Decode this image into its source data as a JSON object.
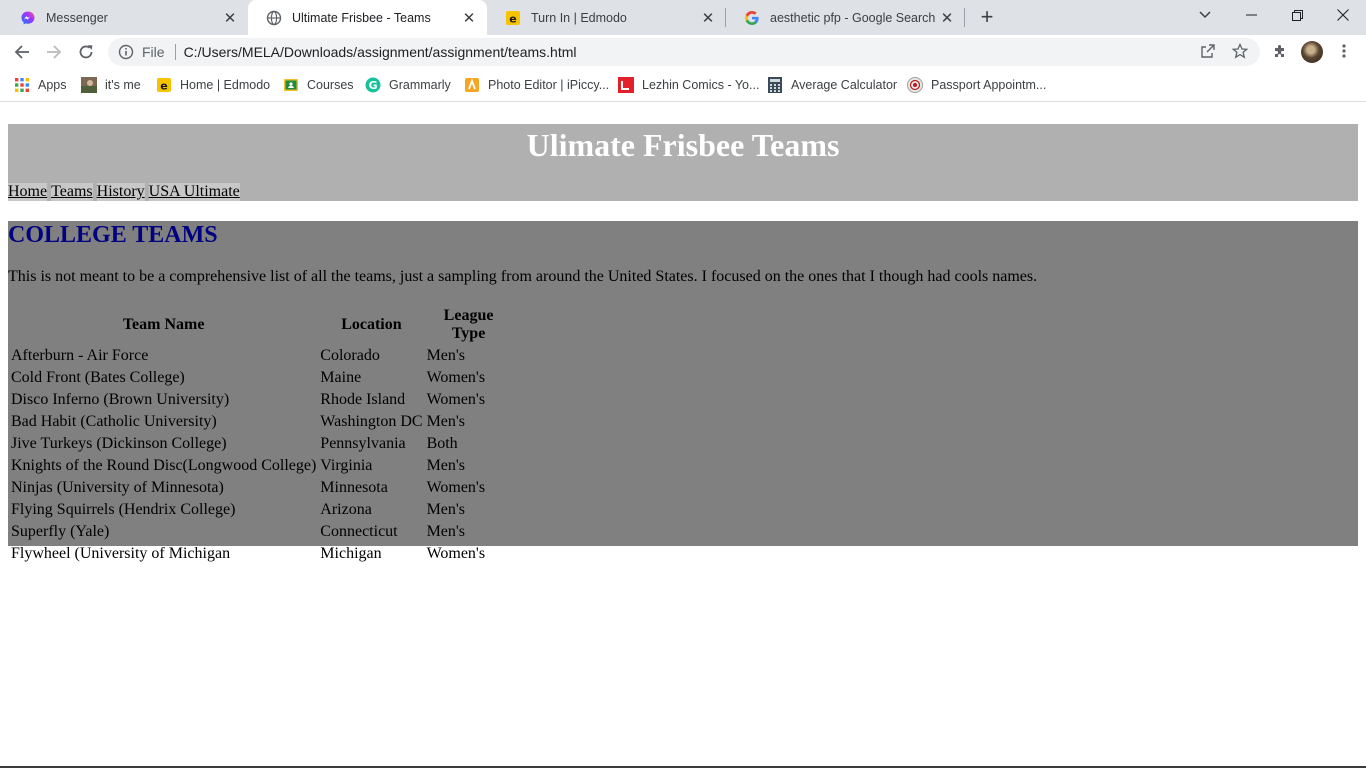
{
  "browser": {
    "tabs": [
      {
        "title": "Messenger",
        "icon": "messenger-icon",
        "active": false
      },
      {
        "title": "Ultimate Frisbee - Teams",
        "icon": "globe-icon",
        "active": true
      },
      {
        "title": "Turn In | Edmodo",
        "icon": "edmodo-icon",
        "active": false
      },
      {
        "title": "aesthetic pfp - Google Search",
        "icon": "google-icon",
        "active": false
      }
    ],
    "new_tab_label": "+",
    "address": {
      "scheme": "File",
      "url": "C:/Users/MELA/Downloads/assignment/assignment/teams.html"
    },
    "bookmarks": [
      {
        "label": "Apps",
        "icon": "apps-grid-icon"
      },
      {
        "label": "it's me",
        "icon": "photo-icon"
      },
      {
        "label": "Home | Edmodo",
        "icon": "edmodo-icon"
      },
      {
        "label": "Courses",
        "icon": "classroom-icon"
      },
      {
        "label": "Grammarly",
        "icon": "grammarly-icon"
      },
      {
        "label": "Photo Editor | iPiccy...",
        "icon": "ipiccy-icon"
      },
      {
        "label": "Lezhin Comics - Yo...",
        "icon": "lezhin-icon"
      },
      {
        "label": "Average Calculator",
        "icon": "calculator-icon"
      },
      {
        "label": "Passport Appointm...",
        "icon": "passport-seal-icon"
      }
    ]
  },
  "page": {
    "site_title": "Ulimate Frisbee Teams",
    "nav": [
      "Home",
      "Teams",
      "History",
      "USA Ultimate"
    ],
    "section_heading": "COLLEGE TEAMS",
    "intro": "This is not meant to be a comprehensive list of all the teams, just a sampling from around the United States. I focused on the ones that I though had cools names.",
    "table": {
      "headers": [
        "Team Name",
        "Location",
        "League Type"
      ],
      "rows": [
        [
          "Afterburn - Air Force",
          "Colorado",
          "Men's"
        ],
        [
          "Cold Front (Bates College)",
          "Maine",
          "Women's"
        ],
        [
          "Disco Inferno (Brown University)",
          "Rhode Island",
          "Women's"
        ],
        [
          "Bad Habit (Catholic University)",
          "Washington DC",
          "Men's"
        ],
        [
          "Jive Turkeys (Dickinson College)",
          "Pennsylvania",
          "Both"
        ],
        [
          "Knights of the Round Disc(Longwood College)",
          "Virginia",
          "Men's"
        ],
        [
          "Ninjas (University of Minnesota)",
          "Minnesota",
          "Women's"
        ],
        [
          "Flying Squirrels (Hendrix College)",
          "Arizona",
          "Men's"
        ],
        [
          "Superfly (Yale)",
          "Connecticut",
          "Men's"
        ],
        [
          "Flywheel (University of Michigan",
          "Michigan",
          "Women's"
        ]
      ]
    }
  },
  "colors": {
    "header_bg": "#b0b0b0",
    "content_bg": "#808080",
    "heading": "#000080",
    "title_text": "#ffffff"
  }
}
